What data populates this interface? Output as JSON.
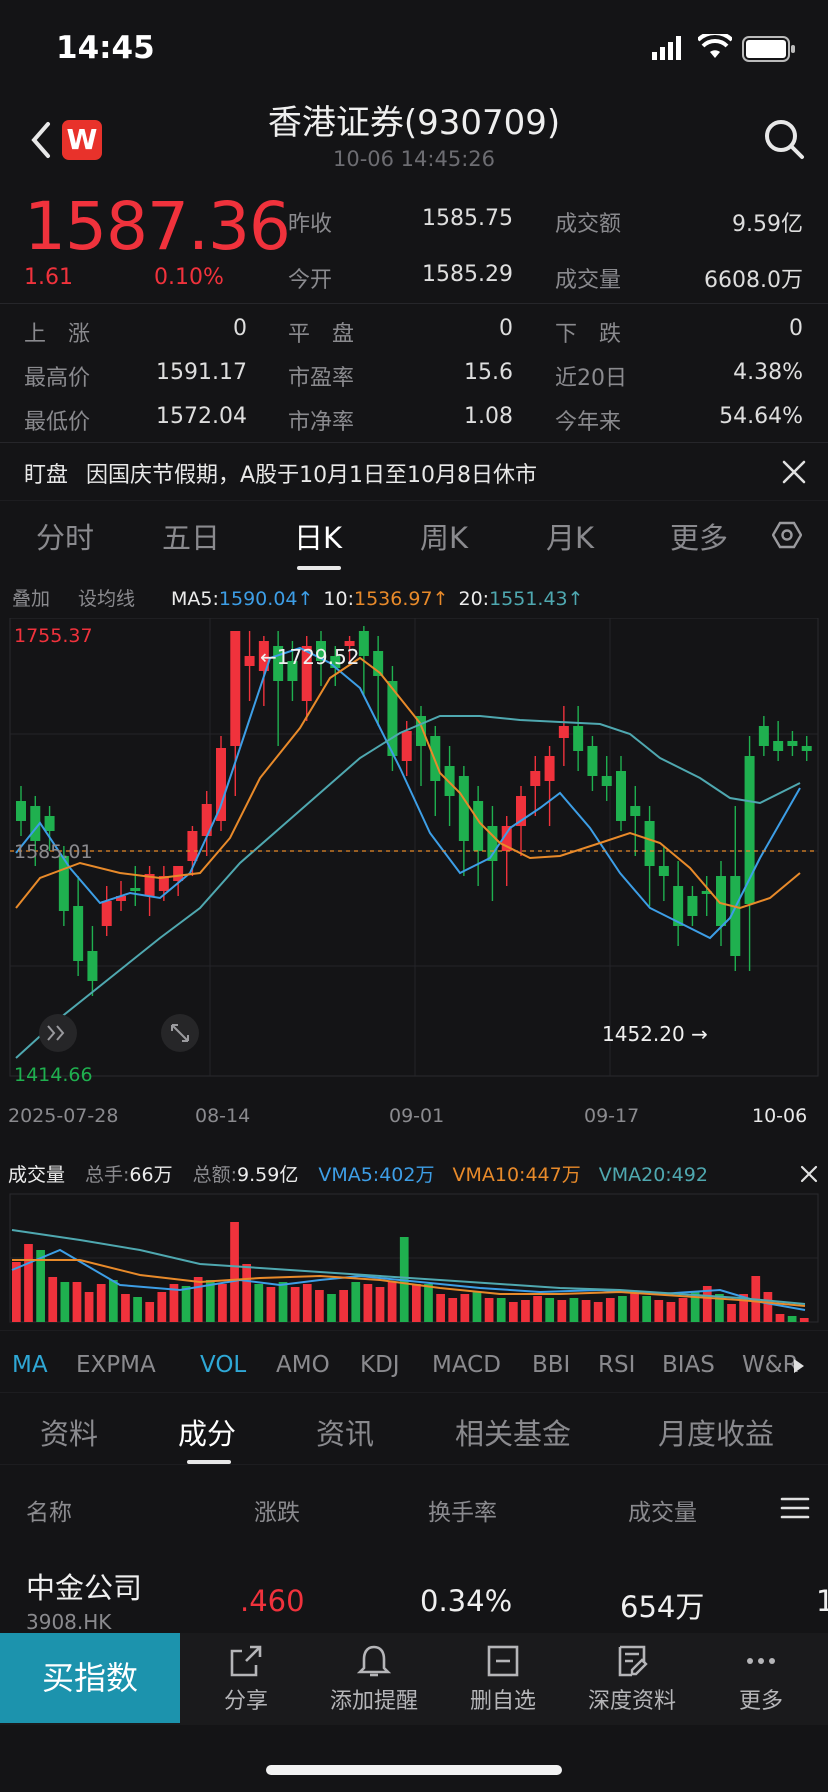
{
  "status_bar": {
    "time": "14:45"
  },
  "header": {
    "logo_letter": "W",
    "title": "香港证券(930709)",
    "timestamp": "10-06 14:45:26"
  },
  "quote": {
    "price": "1587.36",
    "change": "1.61",
    "change_pct": "0.10%",
    "stats": [
      {
        "label": "昨收",
        "value": "1585.75"
      },
      {
        "label": "成交额",
        "value": "9.59亿"
      },
      {
        "label": "今开",
        "value": "1585.29"
      },
      {
        "label": "成交量",
        "value": "6608.0万"
      }
    ]
  },
  "breadth": {
    "up_label": "上　涨",
    "up_value": "0",
    "flat_label": "平　盘",
    "flat_value": "0",
    "down_label": "下　跌",
    "down_value": "0",
    "high_label": "最高价",
    "high_value": "1591.17",
    "pe_label": "市盈率",
    "pe_value": "15.6",
    "d20_label": "近20日",
    "d20_value": "4.38%",
    "low_label": "最低价",
    "low_value": "1572.04",
    "pb_label": "市净率",
    "pb_value": "1.08",
    "ytd_label": "今年来",
    "ytd_value": "54.64%"
  },
  "notice": {
    "tag": "盯盘",
    "text": "因国庆节假期，A股于10月1日至10月8日休市"
  },
  "period_tabs": [
    {
      "label": "分时"
    },
    {
      "label": "五日"
    },
    {
      "label": "日K"
    },
    {
      "label": "周K"
    },
    {
      "label": "月K"
    },
    {
      "label": "更多"
    }
  ],
  "ma_bar": {
    "overlay": "叠加",
    "set_ma": "设均线",
    "ma5_label": "MA5:",
    "ma5_value": "1590.04↑",
    "ma10_label": "10:",
    "ma10_value": "1536.97↑",
    "ma20_label": "20:",
    "ma20_value": "1551.43↑"
  },
  "kline": {
    "top_label": "1755.37",
    "bottom_label": "1414.66",
    "mid_label": "1585.01",
    "max_annot": "←1729.52",
    "min_annot": "1452.20 →",
    "dates": [
      "2025-07-28",
      "08-14",
      "09-01",
      "09-17",
      "10-06"
    ]
  },
  "volume": {
    "title": "成交量",
    "total_hands_label": "总手:",
    "total_hands": "66万",
    "total_amount_label": "总额:",
    "total_amount": "9.59亿",
    "vma5": "VMA5:402万",
    "vma10": "VMA10:447万",
    "vma20": "VMA20:492"
  },
  "indicator_tabs": [
    "MA",
    "EXPMA",
    "VOL",
    "AMO",
    "KDJ",
    "MACD",
    "BBI",
    "RSI",
    "BIAS",
    "W&R"
  ],
  "section_tabs": [
    "资料",
    "成分",
    "资讯",
    "相关基金",
    "月度收益"
  ],
  "table": {
    "headers": [
      "名称",
      "涨跌",
      "换手率",
      "成交量"
    ],
    "rows": [
      {
        "name": "中金公司",
        "code": "3908.HK",
        "change": ".460",
        "turnover": "0.34%",
        "volume": "654万",
        "extra": "1"
      }
    ]
  },
  "bottom_bar": {
    "buy": "买指数",
    "items": [
      "分享",
      "添加提醒",
      "删自选",
      "深度资料",
      "更多"
    ]
  },
  "colors": {
    "up": "#f0323c",
    "down": "#1fb04f",
    "ma5": "#3d9ee6",
    "ma10": "#e88a2a",
    "ma20": "#4fa8b0",
    "accent": "#1c93ad"
  }
}
